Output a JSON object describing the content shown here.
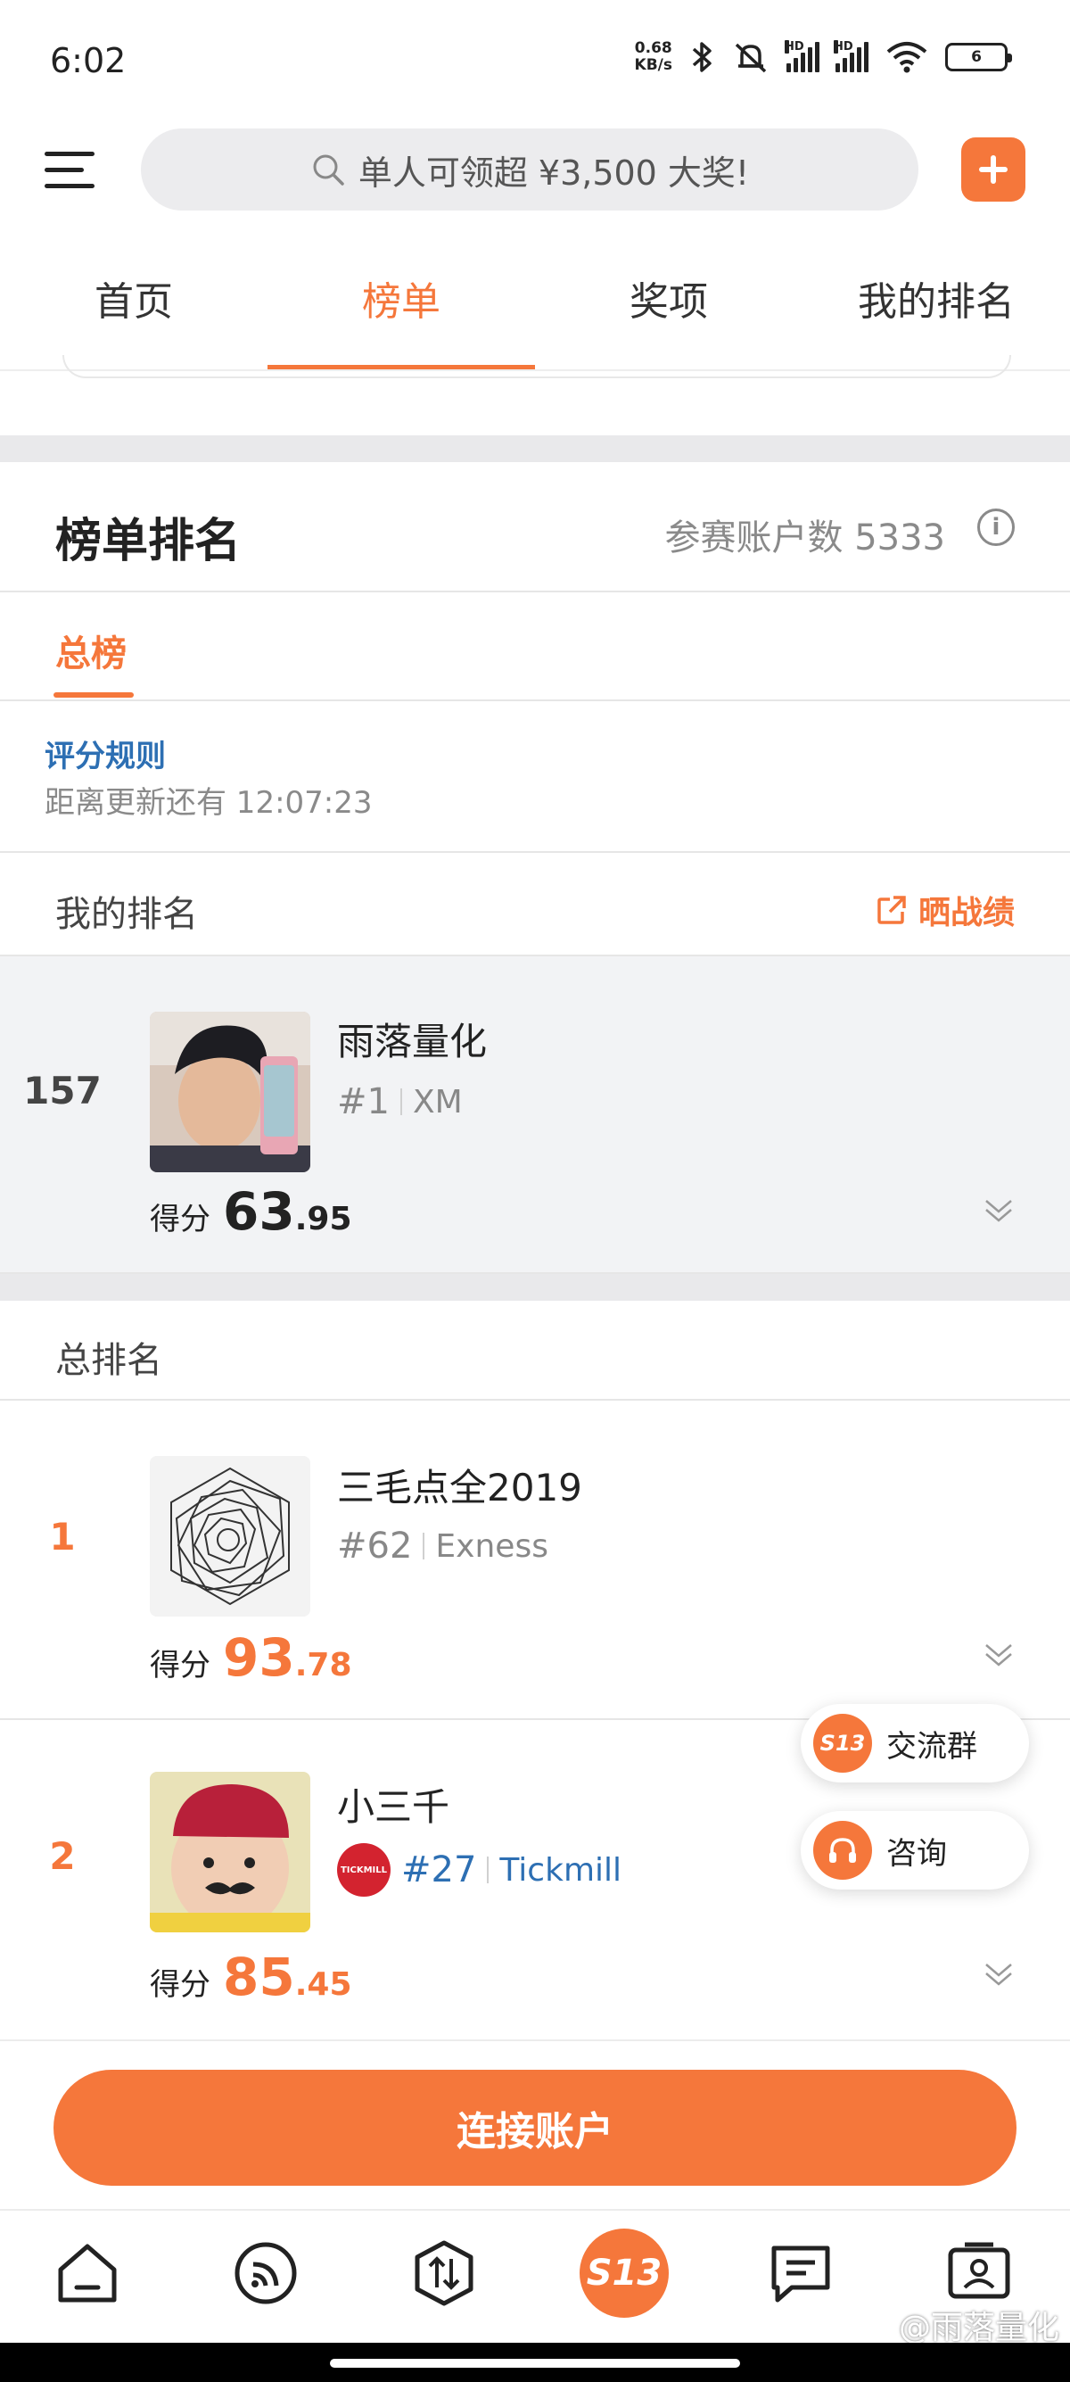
{
  "status_bar": {
    "time": "6:02",
    "speed_value": "0.68",
    "speed_unit": "KB/s",
    "hd_label": "HD",
    "battery": "6"
  },
  "header": {
    "search_placeholder": "单人可领超 ¥3,500 大奖!"
  },
  "tabs": [
    {
      "label": "首页",
      "active": false
    },
    {
      "label": "榜单",
      "active": true
    },
    {
      "label": "奖项",
      "active": false
    },
    {
      "label": "我的排名",
      "active": false
    }
  ],
  "ranking": {
    "title": "榜单排名",
    "participants_label": "参赛账户数 5333",
    "info_icon": "i",
    "sub_tab": "总榜",
    "rules_link": "评分规则",
    "countdown": "距离更新还有 12:07:23",
    "my_rank_title": "我的排名",
    "share_label": "晒战绩",
    "score_label": "得分",
    "total_title": "总排名"
  },
  "my_entry": {
    "rank": "157",
    "name": "雨落量化",
    "account": "#1",
    "broker": "XM",
    "score_int": "63",
    "score_dec": ".95"
  },
  "entries": [
    {
      "rank": "1",
      "name": "三毛点全2019",
      "account": "#62",
      "broker": "Exness",
      "score_int": "93",
      "score_dec": ".78"
    },
    {
      "rank": "2",
      "name": "小三千",
      "account": "#27",
      "broker": "Tickmill",
      "broker_logo_text": "TICKMILL",
      "score_int": "85",
      "score_dec": ".45"
    }
  ],
  "floating": {
    "group_label": "交流群",
    "group_icon_text": "S13",
    "consult_label": "咨询"
  },
  "connect_button": "连接账户",
  "bottom_nav": {
    "center_label": "S13"
  },
  "watermark": "@雨落量化",
  "colors": {
    "accent": "#f5773b",
    "link": "#2d6fb3",
    "muted": "#8a8a8a",
    "divider": "#e9e9eb"
  }
}
